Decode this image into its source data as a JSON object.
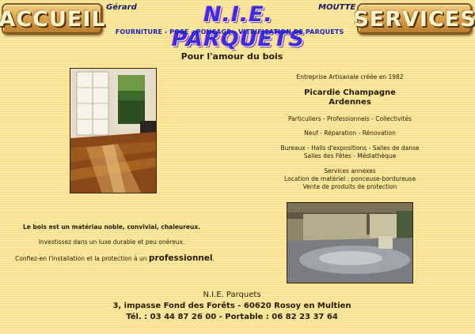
{
  "header": {
    "accueil_label": "ACCUEIL",
    "services_label": "SERVICES",
    "first_name": "Gérard",
    "last_name": "MOUTTE",
    "logo_text": "N.I.E. PARQUETS",
    "tagline": "FOURNITURE - POSE - PONCAGE - VITRIFICATION DE PARQUETS"
  },
  "main": {
    "heading": "Pour l'amour du bois",
    "founded": "Entreprise Artisanale créée en 1982",
    "region_1": "Picardie Champagne",
    "region_2": "Ardennes",
    "clients": "Particuliers - Professionnels - Collectivités",
    "work": "Neuf - Réparation - Rénovation",
    "venues_1": "Bureaux - Halls d'expositions - Salles de danse",
    "venues_2": "Salles des Fêtes - Médiathèque",
    "annex_title": "Services annexes",
    "annex_1": "Location de matériel : ponceuse-bordureuse",
    "annex_2": "Vente de produits de protection",
    "wood_text": "Le bois est un matériau noble, convivial, chaleureux.",
    "invest_text": "Investissez dans un luxe durable et peu onéreux.",
    "trust_text": "Confiez-en l'installation et la protection à un",
    "trust_bold": "professionnel",
    "trust_end": "."
  },
  "footer": {
    "company": "N.I.E. Parquets",
    "address": "3, impasse Fond des Forêts - 60620 Rosoy en Multien",
    "phone": "Tél. : 03 44 87 26 00 - Portable : 06 82 23 37 64"
  },
  "colors": {
    "background": "#fde9a0",
    "button_gold": "#d9a34b",
    "logo_blue": "#3a2fe0",
    "tagline_blue": "#2020c0"
  }
}
